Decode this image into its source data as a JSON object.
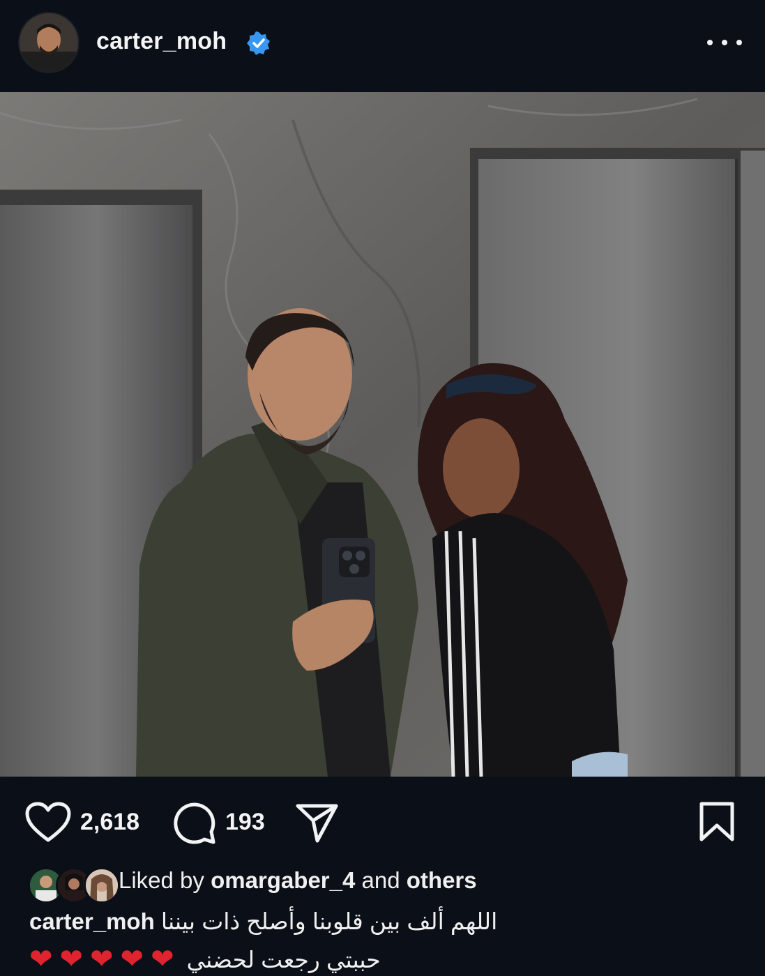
{
  "post": {
    "username": "carter_moh",
    "verified": true,
    "menu_icon": "more-horizontal-icon"
  },
  "actions": {
    "likes": "2,618",
    "comments": "193"
  },
  "liked_by": {
    "prefix": "Liked by",
    "user": "omargaber_4",
    "connector": "and",
    "suffix": "others"
  },
  "caption": {
    "username": "carter_moh",
    "line1": "اللهم ألف بين قلوبنا وأصلح ذات بيننا",
    "line2": "حببتي رجعت لحضني",
    "hearts": [
      "❤",
      "❤",
      "❤",
      "❤",
      "❤"
    ]
  },
  "colors": {
    "background": "#0b0f17",
    "verified": "#3897f0",
    "heart": "#e0242f"
  }
}
